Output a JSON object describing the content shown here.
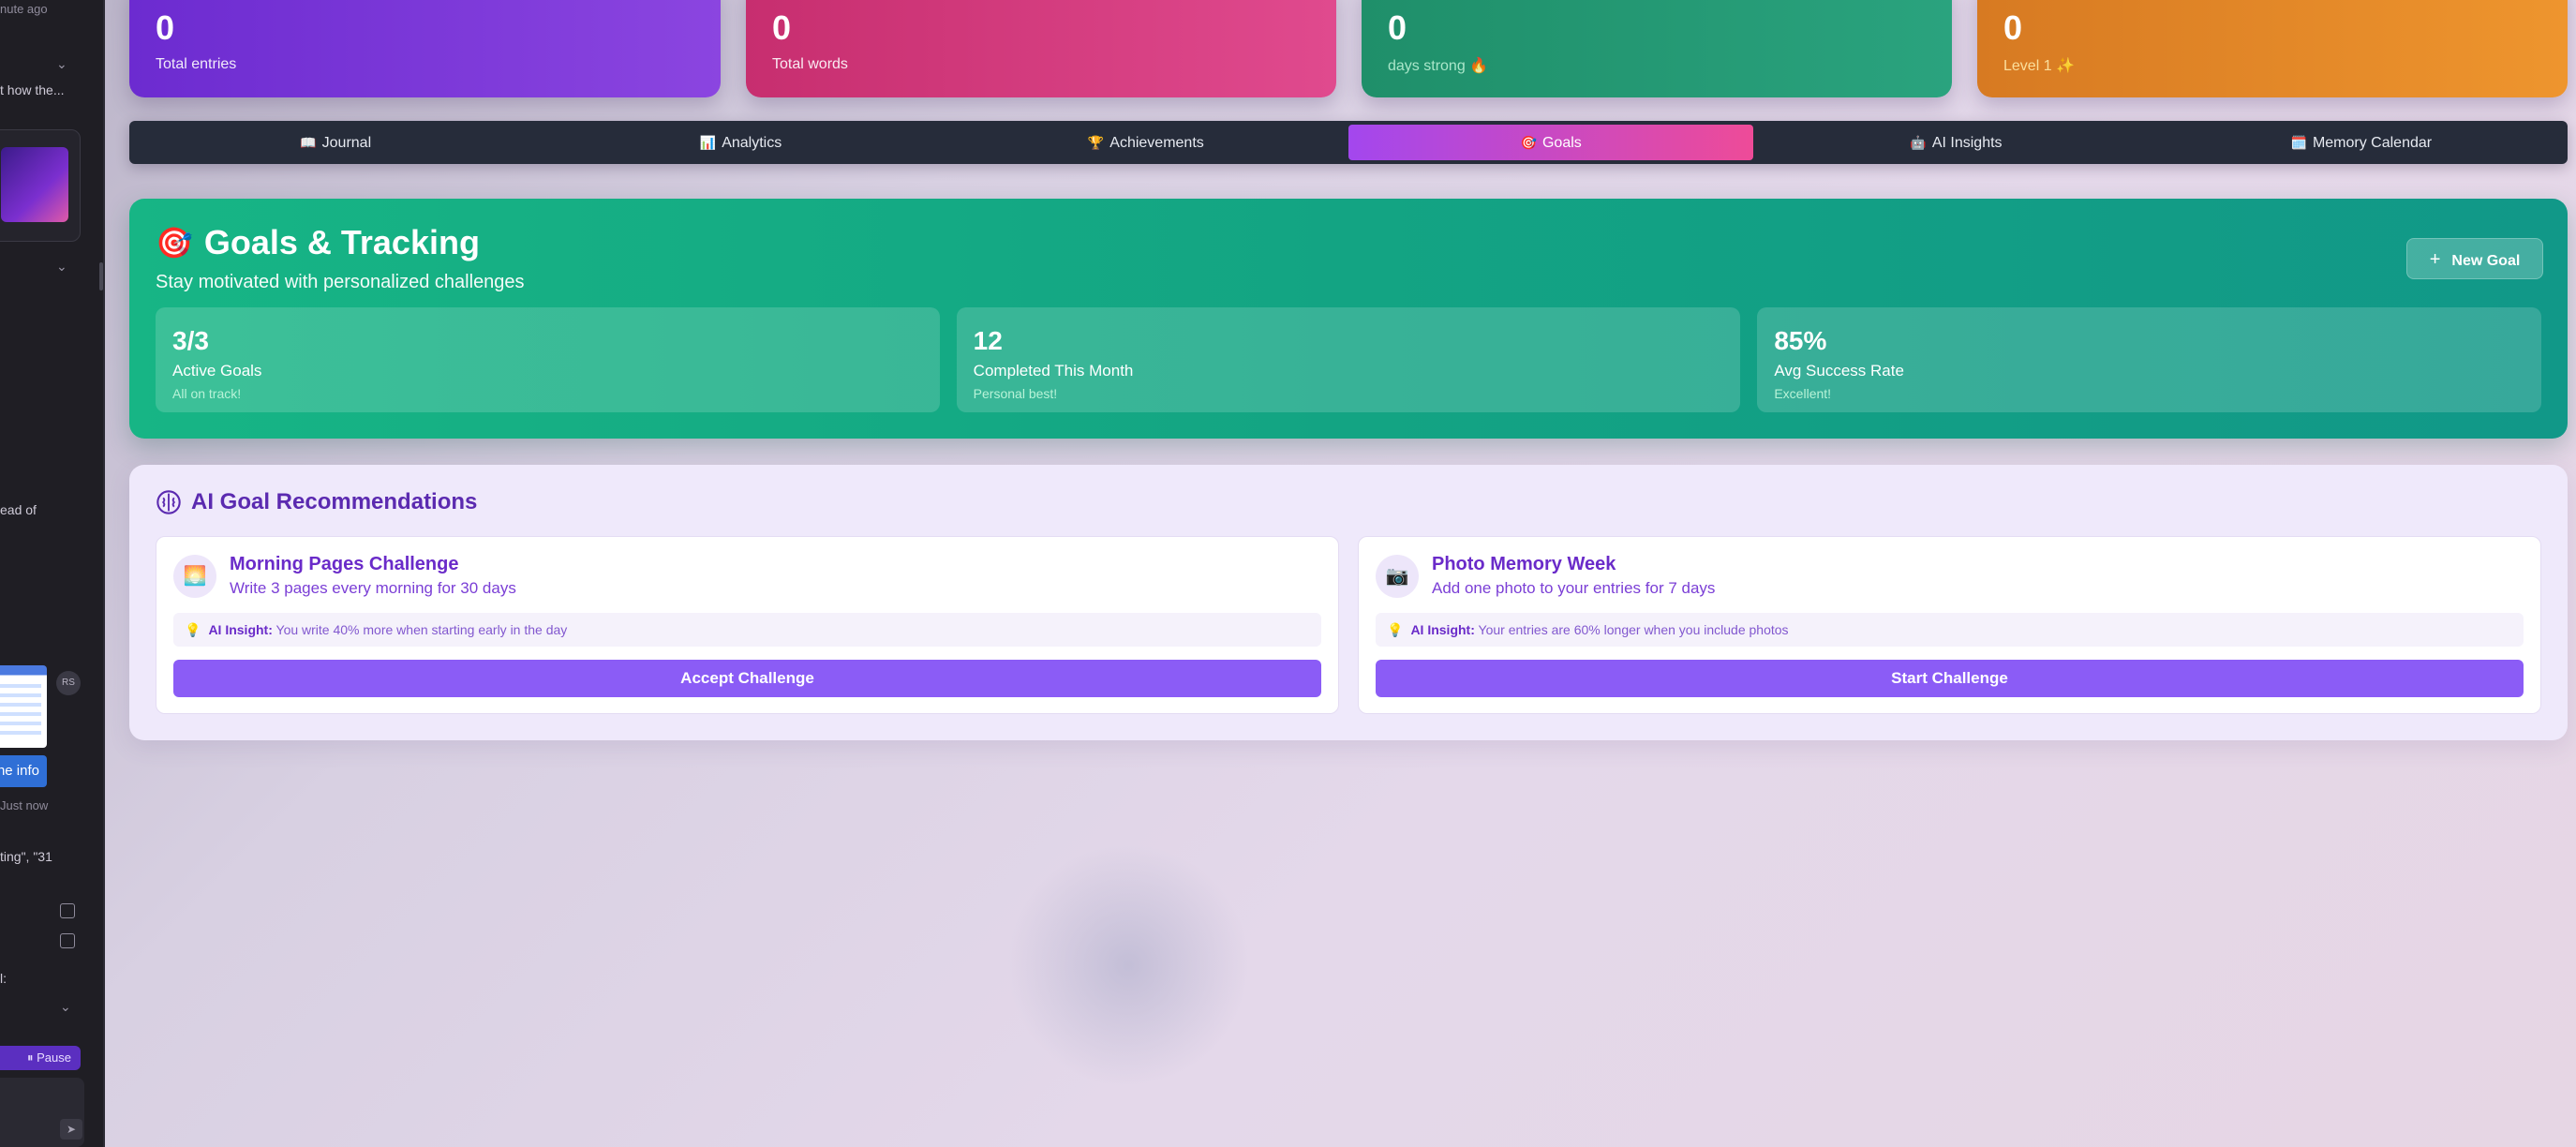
{
  "left_panel": {
    "time_ago": "nute ago",
    "snippet_1": "t how the...",
    "snippet_2": "ead of",
    "avatar_initials": "RS",
    "info_button": "ne info",
    "just_now": "Just now",
    "snippet_3": "ting\", \"31",
    "snippet_4": "l:",
    "pause_label": "⏸ Pause"
  },
  "stats": [
    {
      "value": "0",
      "label": "Total entries"
    },
    {
      "value": "0",
      "label": "Total words"
    },
    {
      "value": "0",
      "label": "days strong 🔥"
    },
    {
      "value": "0",
      "label": "Level 1 ✨"
    }
  ],
  "tabs": [
    {
      "icon": "📖",
      "label": "Journal",
      "active": false
    },
    {
      "icon": "📊",
      "label": "Analytics",
      "active": false
    },
    {
      "icon": "🏆",
      "label": "Achievements",
      "active": false
    },
    {
      "icon": "🎯",
      "label": "Goals",
      "active": true
    },
    {
      "icon": "🤖",
      "label": "AI Insights",
      "active": false
    },
    {
      "icon": "🗓️",
      "label": "Memory Calendar",
      "active": false
    }
  ],
  "goals": {
    "icon": "🎯",
    "title": "Goals & Tracking",
    "subtitle": "Stay motivated with personalized challenges",
    "new_goal_label": "New Goal",
    "stats": [
      {
        "value": "3/3",
        "label": "Active Goals",
        "note": "All on track!"
      },
      {
        "value": "12",
        "label": "Completed This Month",
        "note": "Personal best!"
      },
      {
        "value": "85%",
        "label": "Avg Success Rate",
        "note": "Excellent!"
      }
    ]
  },
  "recommendations": {
    "title": "AI Goal Recommendations",
    "cards": [
      {
        "icon": "🌅",
        "name": "Morning Pages Challenge",
        "description": "Write 3 pages every morning for 30 days",
        "insight_label": "AI Insight:",
        "insight_text": "You write 40% more when starting early in the day",
        "button": "Accept Challenge"
      },
      {
        "icon": "📷",
        "name": "Photo Memory Week",
        "description": "Add one photo to your entries for 7 days",
        "insight_label": "AI Insight:",
        "insight_text": "Your entries are 60% longer when you include photos",
        "button": "Start Challenge"
      }
    ]
  },
  "colors": {
    "goals_panel": "#17b585",
    "active_tab_start": "#a347ee",
    "active_tab_end": "#ee4b98",
    "challenge_button": "#8b5cf6"
  }
}
